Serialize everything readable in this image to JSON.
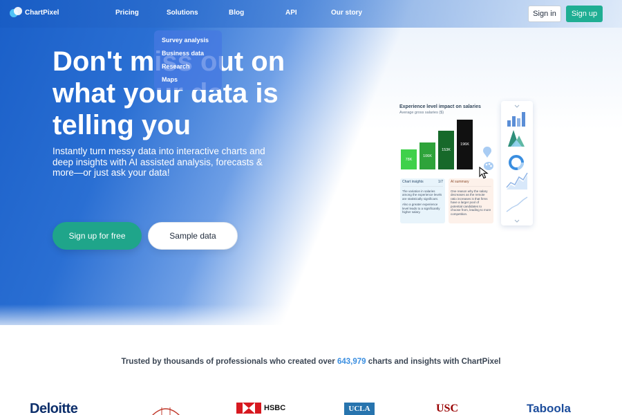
{
  "nav": {
    "logo_text": "ChartPixel",
    "links": [
      "Pricing",
      "Solutions",
      "Blog",
      "API",
      "Our story"
    ],
    "signin_label": "Sign in",
    "signup_label": "Sign up"
  },
  "dropdown": {
    "items": [
      "Survey analysis",
      "Business data",
      "Research",
      "Maps"
    ]
  },
  "hero": {
    "headline": "Don't miss out on what your data is telling you",
    "subline": "Instantly turn messy data into interactive charts and deep insights with AI assisted analysis, forecasts & more—or just ask your data!",
    "cta_primary": "Sign up for free",
    "cta_secondary": "Sample data"
  },
  "mockup": {
    "title": "Experience level impact on salaries",
    "subtitle": "Average gross salaries ($)",
    "bars": [
      {
        "label": "78K",
        "value": 78,
        "color": "#3fd14a"
      },
      {
        "label": "106K",
        "value": 106,
        "color": "#2ea33a"
      },
      {
        "label": "153K",
        "value": 153,
        "color": "#17692a"
      },
      {
        "label": "196K",
        "value": 196,
        "color": "#111111"
      }
    ],
    "insights_title": "Chart insights",
    "insights_page": "1/7",
    "insights_p1": "The variation in salaries among the experience levels are statistically significant.",
    "insights_p2": "Also a greater experience level leads to a significantly higher salary.",
    "summary_title": "AI summary",
    "summary_p1": "One reason why the salary decreases as the remote ratio increases is that firms have a larger pool of potential candidates to choose from, leading to more competition."
  },
  "trusted": {
    "prefix": "Trusted by thousands of professionals who created over",
    "count": "643,979",
    "suffix": "charts and insights with ChartPixel"
  },
  "brands": {
    "deloitte": "Deloitte",
    "hsbc": "HSBC",
    "ucla": "UCLA",
    "usc": "USC",
    "taboola": "Taboola"
  },
  "colors": {
    "brand_green": "#1fae93",
    "hero_blue": "#1a5fc8",
    "count_blue": "#3a8ee0"
  }
}
